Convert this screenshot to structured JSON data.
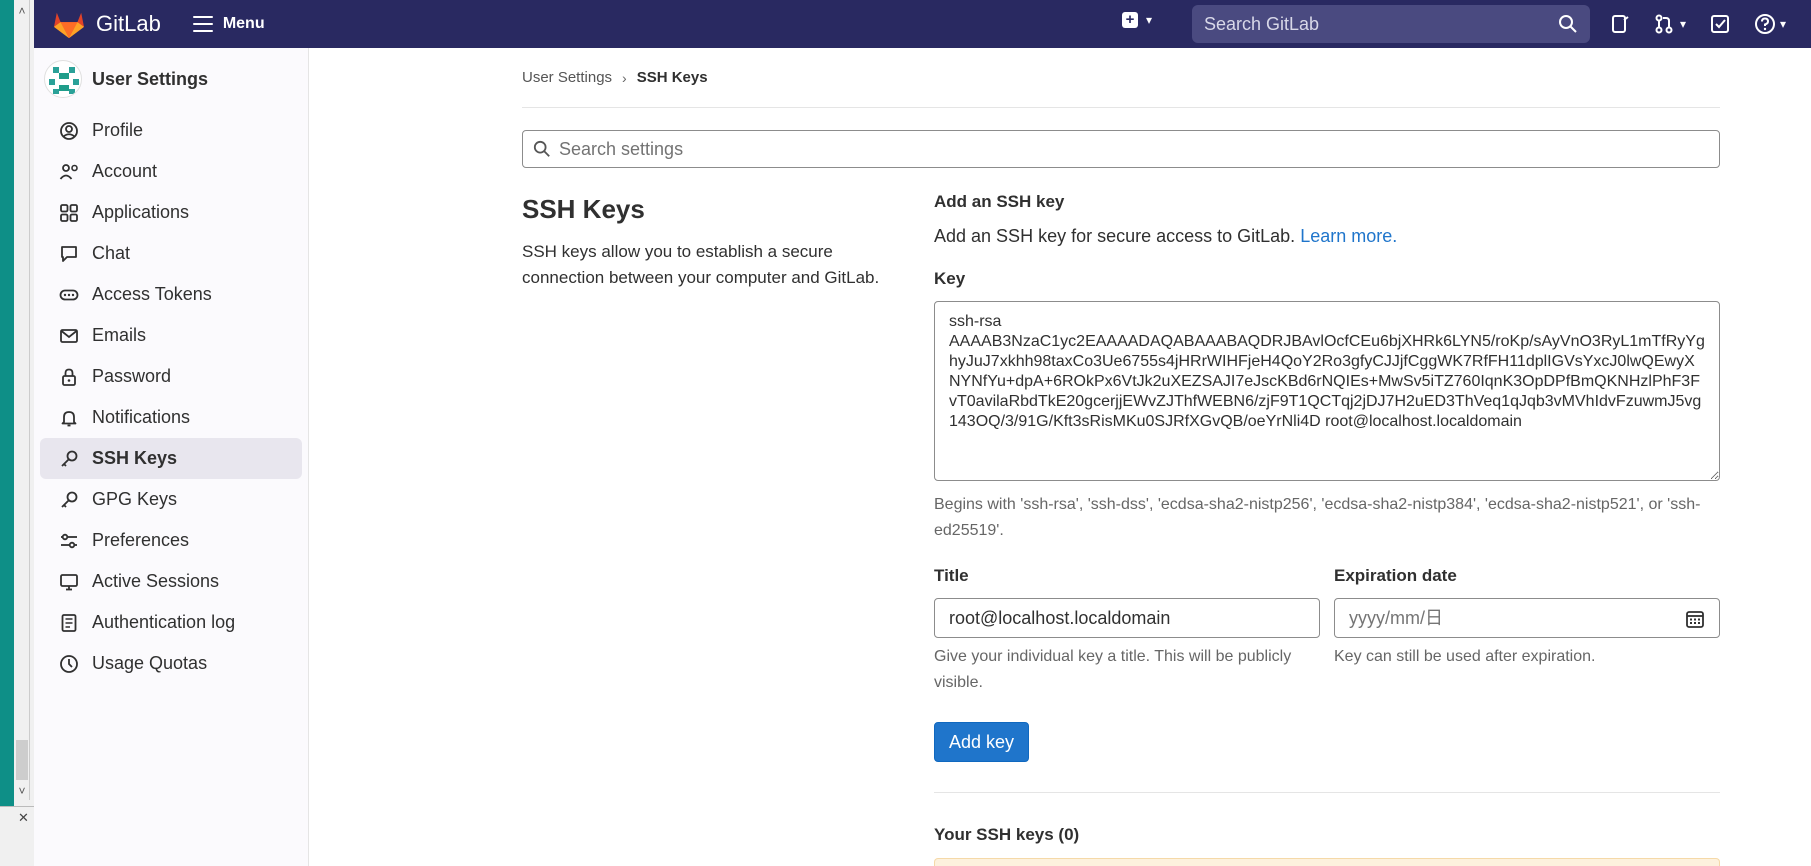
{
  "topbar": {
    "brand": "GitLab",
    "menu_label": "Menu",
    "search_placeholder": "Search GitLab"
  },
  "sidebar": {
    "title": "User Settings",
    "items": [
      {
        "label": "Profile",
        "icon": "profile-icon"
      },
      {
        "label": "Account",
        "icon": "account-icon"
      },
      {
        "label": "Applications",
        "icon": "applications-icon"
      },
      {
        "label": "Chat",
        "icon": "chat-icon"
      },
      {
        "label": "Access Tokens",
        "icon": "token-icon"
      },
      {
        "label": "Emails",
        "icon": "mail-icon"
      },
      {
        "label": "Password",
        "icon": "lock-icon"
      },
      {
        "label": "Notifications",
        "icon": "bell-icon"
      },
      {
        "label": "SSH Keys",
        "icon": "key-icon",
        "active": true
      },
      {
        "label": "GPG Keys",
        "icon": "key-icon"
      },
      {
        "label": "Preferences",
        "icon": "preferences-icon"
      },
      {
        "label": "Active Sessions",
        "icon": "monitor-icon"
      },
      {
        "label": "Authentication log",
        "icon": "log-icon"
      },
      {
        "label": "Usage Quotas",
        "icon": "quota-icon"
      }
    ]
  },
  "breadcrumb": {
    "parent": "User Settings",
    "current": "SSH Keys"
  },
  "settings_search_placeholder": "Search settings",
  "section": {
    "title": "SSH Keys",
    "description": "SSH keys allow you to establish a secure connection between your computer and GitLab."
  },
  "form": {
    "heading": "Add an SSH key",
    "intro": "Add an SSH key for secure access to GitLab.",
    "learn_more": "Learn more.",
    "key_label": "Key",
    "key_value": "ssh-rsa\nAAAAB3NzaC1yc2EAAAADAQABAAABAQDRJBAvlOcfCEu6bjXHRk6LYN5/roKp/sAyVnO3RyL1mTfRyYghyJuJ7xkhh98taxCo3Ue6755s4jHRrWIHFjeH4QoY2Ro3gfyCJJjfCggWK7RfFH11dplIGVsYxcJ0lwQEwyXNYNfYu+dpA+6ROkPx6VtJk2uXEZSAJI7eJscKBd6rNQIEs+MwSv5iTZ760IqnK3OpDPfBmQKNHzlPhF3FvT0avilaRbdTkE20gcerjjEWvZJThfWEBN6/zjF9T1QCTqj2jDJ7H2uED3ThVeq1qJqb3vMVhIdvFzuwmJ5vg143OQ/3/91G/Kft3sRisMKu0SJRfXGvQB/oeYrNli4D root@localhost.localdomain",
    "key_help": "Begins with 'ssh-rsa', 'ssh-dss', 'ecdsa-sha2-nistp256', 'ecdsa-sha2-nistp384', 'ecdsa-sha2-nistp521', or 'ssh-ed25519'.",
    "title_label": "Title",
    "title_value": "root@localhost.localdomain",
    "title_help": "Give your individual key a title. This will be publicly visible.",
    "expiration_label": "Expiration date",
    "expiration_placeholder": "yyyy/mm/日",
    "expiration_help": "Key can still be used after expiration.",
    "submit_label": "Add key",
    "your_keys": "Your SSH keys (0)"
  },
  "colors": {
    "topbar": "#292961",
    "accent": "#1f75cb",
    "host_teal": "#0e8f87"
  }
}
